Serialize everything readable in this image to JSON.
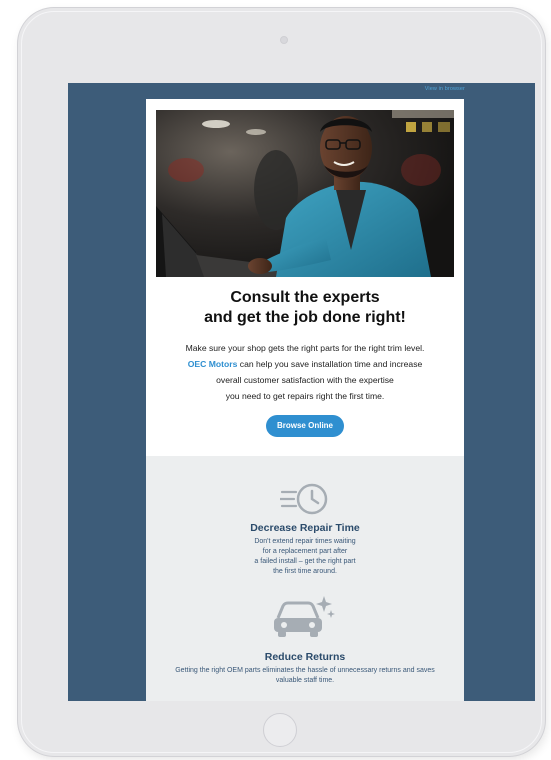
{
  "email": {
    "view_in_browser": "View in browser",
    "headline_line1": "Consult the experts",
    "headline_line2": "and get the job done right!",
    "body_line1": "Make sure your shop gets the right parts for the right trim level.",
    "brand": "OEC Motors",
    "body_line2_rest": " can help you save installation time and increase",
    "body_line3": "overall customer satisfaction with the expertise",
    "body_line4": "you need to get repairs right the first time.",
    "cta_label": "Browse Online"
  },
  "features": [
    {
      "icon": "clock-speed-icon",
      "title": "Decrease Repair Time",
      "desc_lines": [
        "Don't extend repair times waiting",
        "for a replacement part after",
        "a failed install – get the right part",
        "the first time around."
      ]
    },
    {
      "icon": "sparkling-car-icon",
      "title": "Reduce Returns",
      "desc_lines": [
        "Getting the right OEM parts eliminates the hassle of unnecessary returns and saves",
        "valuable staff time."
      ]
    }
  ],
  "colors": {
    "screen_bg": "#3d5c79",
    "accent": "#2f8fd0",
    "feature_bg": "#eceeef",
    "feature_text": "#2b4b6b"
  }
}
